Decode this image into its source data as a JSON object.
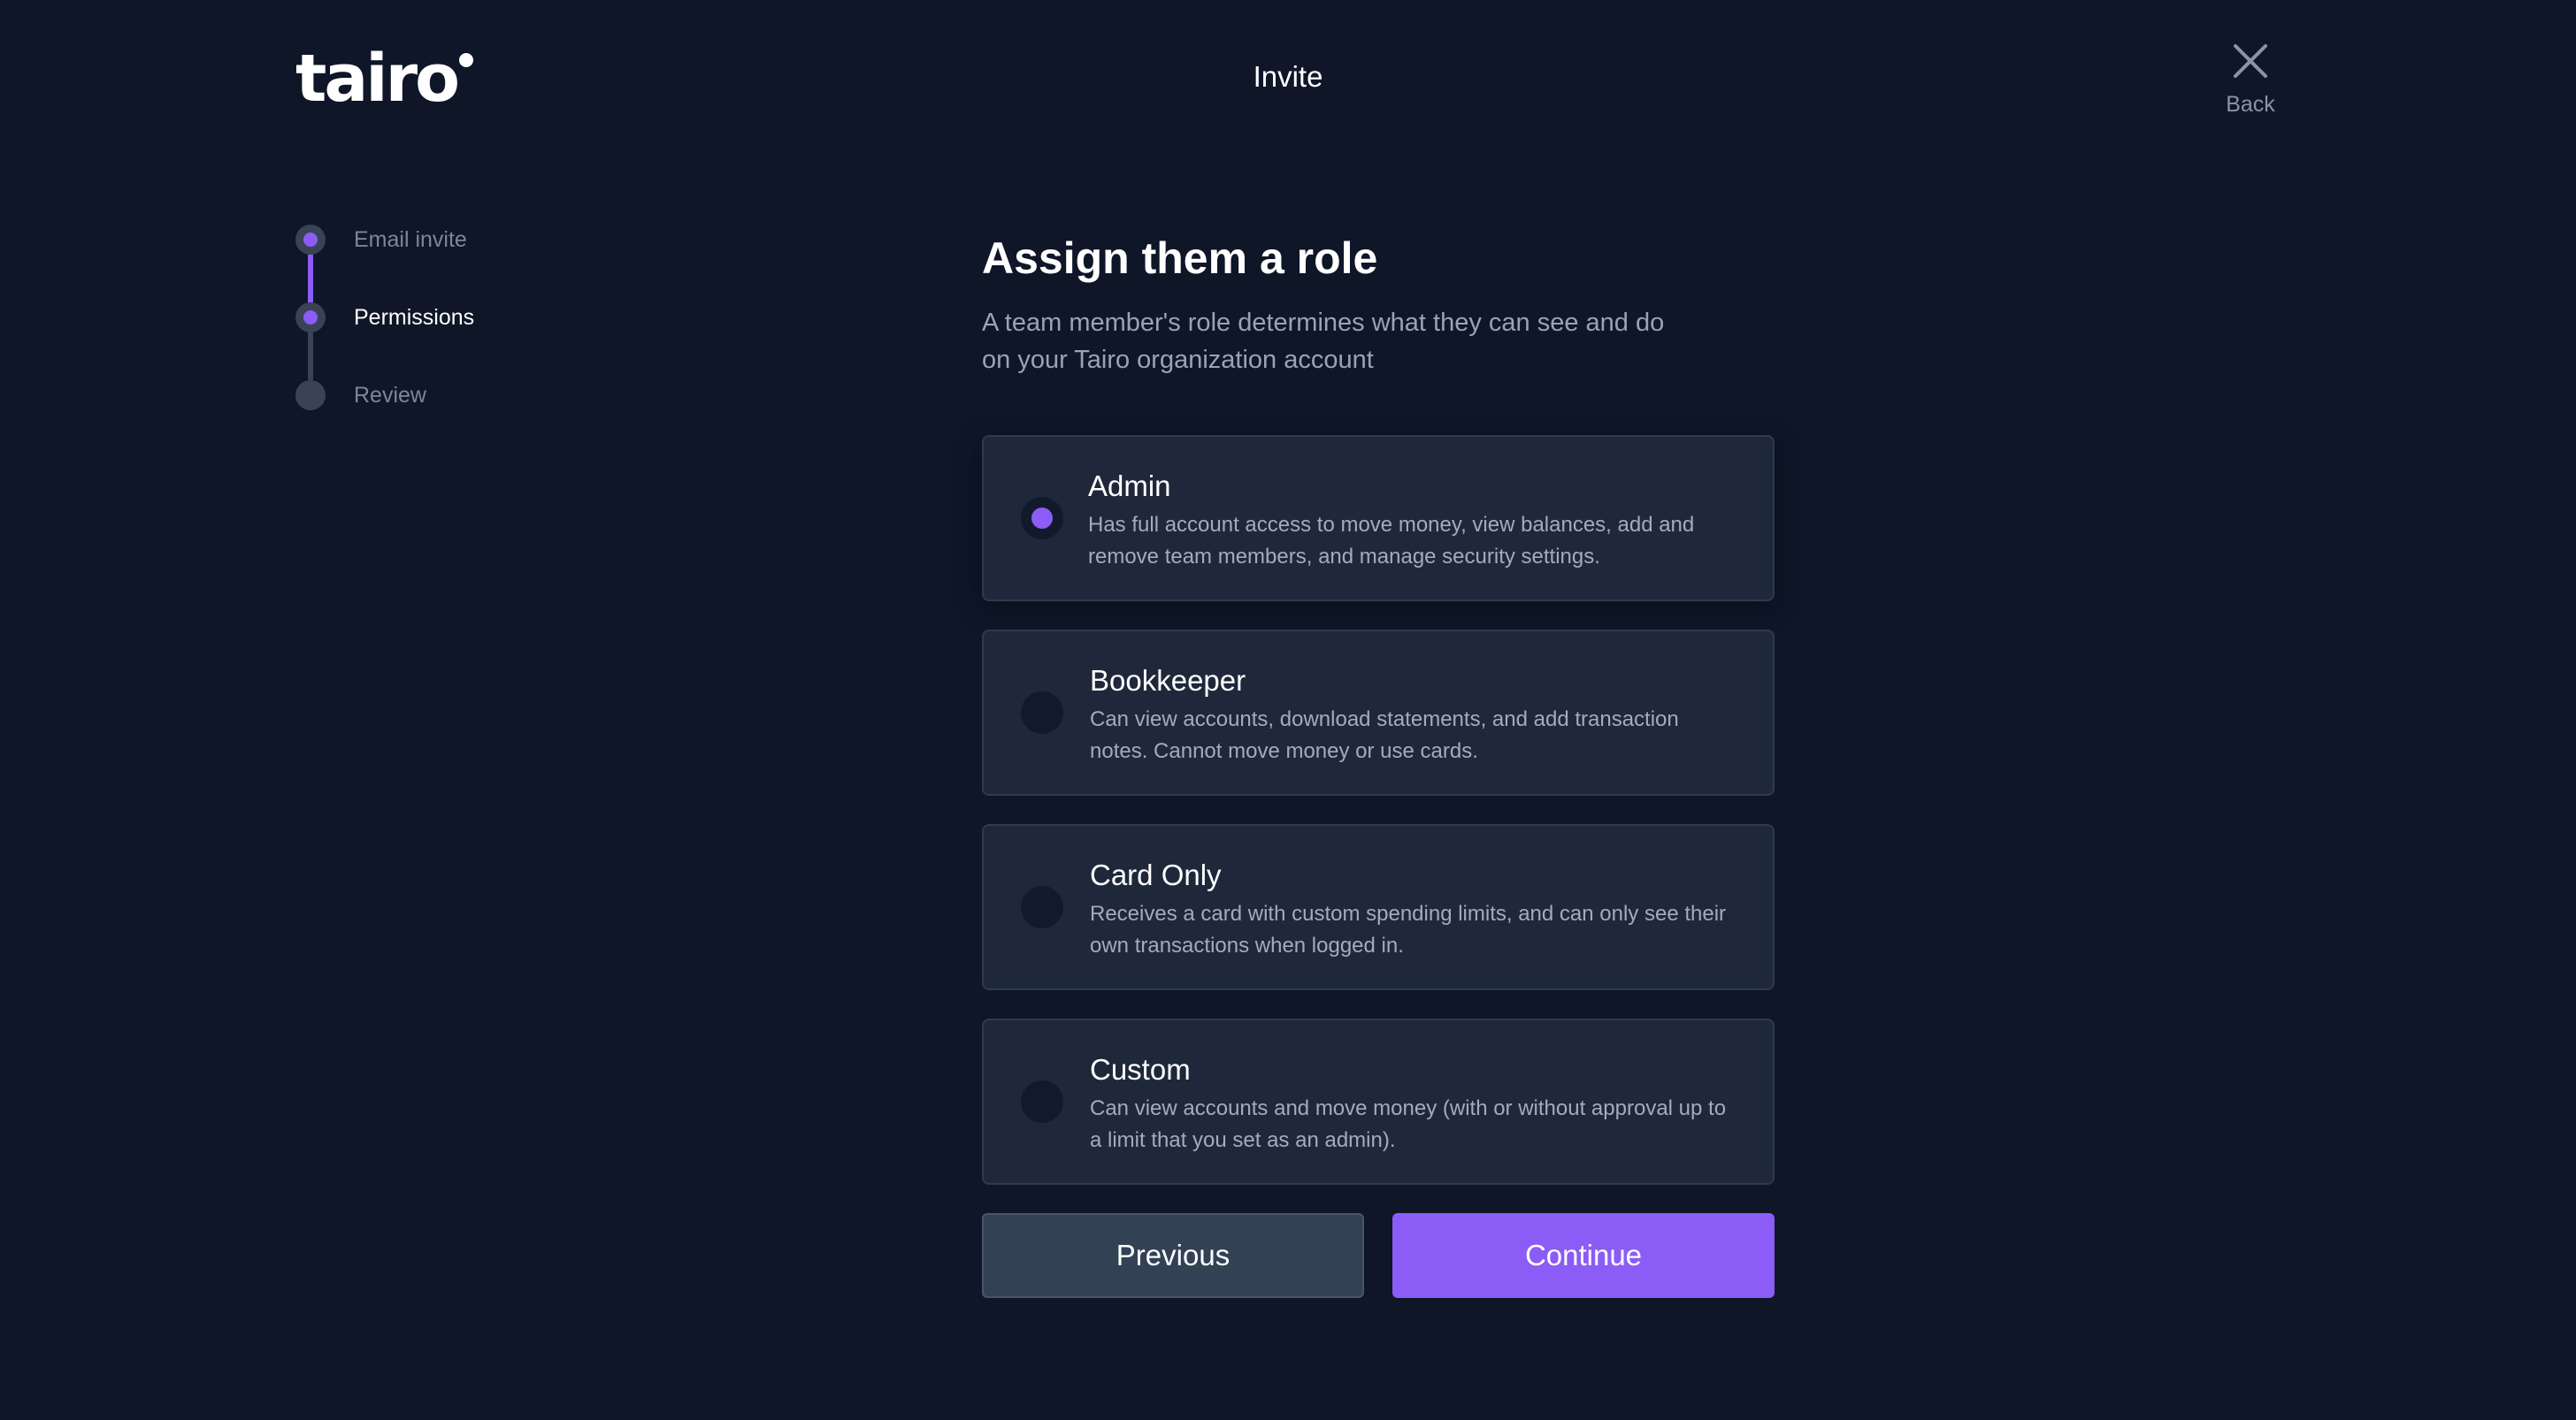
{
  "header": {
    "logo_text": "tairo",
    "title": "Invite",
    "back_label": "Back",
    "back_icon": "close-icon"
  },
  "stepper": {
    "steps": [
      {
        "label": "Email invite",
        "state": "completed"
      },
      {
        "label": "Permissions",
        "state": "current"
      },
      {
        "label": "Review",
        "state": "upcoming"
      }
    ]
  },
  "main": {
    "title": "Assign them a role",
    "subtitle": "A team member's role determines what they can see and do on your Tairo organization account"
  },
  "roles": [
    {
      "title": "Admin",
      "description": "Has full account access to move money, view balances, add and remove team members, and manage security settings.",
      "selected": true
    },
    {
      "title": "Bookkeeper",
      "description": "Can view accounts, download statements, and add transaction notes. Cannot move money or use cards.",
      "selected": false
    },
    {
      "title": "Card Only",
      "description": "Receives a card with custom spending limits, and can only see their own transactions when logged in.",
      "selected": false
    },
    {
      "title": "Custom",
      "description": "Can view accounts and move money (with or without approval up to a limit that you set as an admin).",
      "selected": false
    }
  ],
  "actions": {
    "previous_label": "Previous",
    "continue_label": "Continue"
  },
  "colors": {
    "background": "#0e1628",
    "card": "#1e283a",
    "accent": "#8b5cf6",
    "muted_text": "#9aa3b6"
  }
}
